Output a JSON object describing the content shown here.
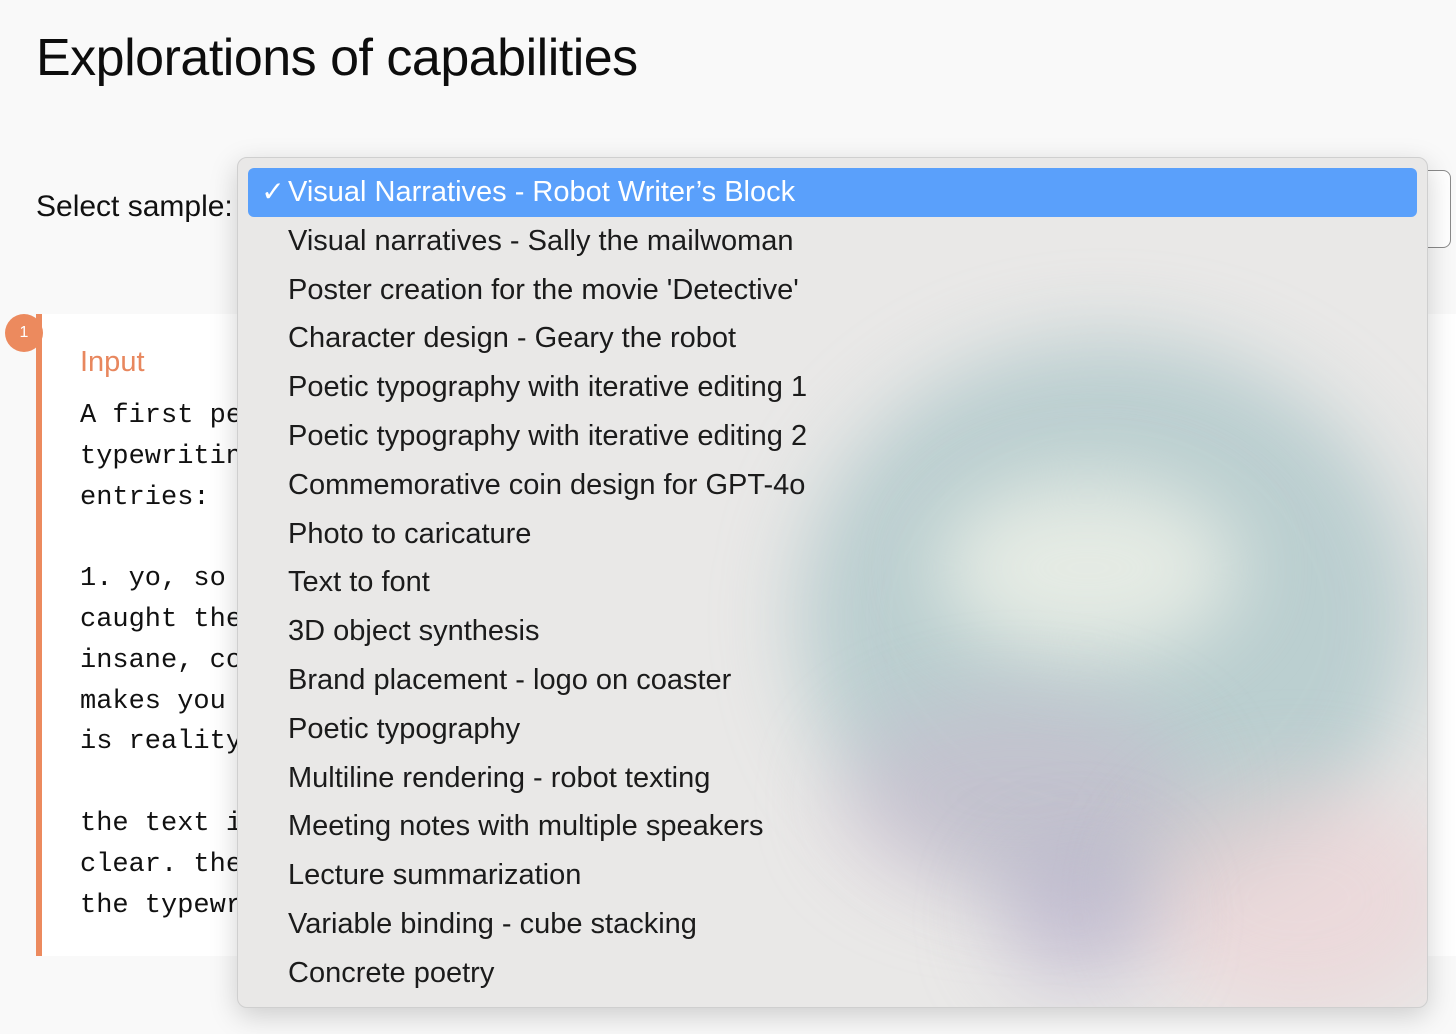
{
  "page": {
    "title": "Explorations of capabilities"
  },
  "selector": {
    "label": "Select sample:"
  },
  "step": {
    "number": "1"
  },
  "card": {
    "input_label": "Input",
    "input_lines": [
      "A first pe",
      "typewritin",
      "entries:",
      "",
      "1. yo, so",
      "caught the",
      "insane, co",
      "makes you",
      "is reality",
      "",
      "the text i",
      "clear. the",
      "the typewr"
    ]
  },
  "dropdown": {
    "selected_index": 0,
    "check_glyph": "✓",
    "colors": {
      "highlight": "#5aa0fb",
      "accent": "#ec8a5e"
    },
    "options": [
      "Visual Narratives - Robot Writer’s Block",
      "Visual narratives - Sally the mailwoman",
      "Poster creation for the movie 'Detective'",
      "Character design - Geary the robot",
      "Poetic typography with iterative editing 1",
      "Poetic typography with iterative editing 2",
      "Commemorative coin design for GPT-4o",
      "Photo to caricature",
      "Text to font",
      "3D object synthesis",
      "Brand placement - logo on coaster",
      "Poetic typography",
      "Multiline rendering - robot texting",
      "Meeting notes with multiple speakers",
      "Lecture summarization",
      "Variable binding - cube stacking",
      "Concrete poetry"
    ]
  }
}
